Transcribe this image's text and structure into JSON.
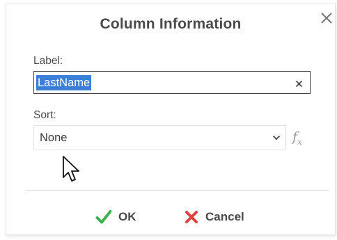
{
  "dialog": {
    "title": "Column Information"
  },
  "label_field": {
    "label": "Label:",
    "value": "LastName"
  },
  "sort_field": {
    "label": "Sort:",
    "value": "None"
  },
  "buttons": {
    "ok": "OK",
    "cancel": "Cancel"
  },
  "icons": {
    "close": "close-icon",
    "clear": "clear-icon",
    "dropdown": "chevron-down-icon",
    "formula": "fx-icon",
    "ok": "checkmark-icon",
    "cancel": "x-icon",
    "pointer": "mouse-cursor-icon"
  },
  "colors": {
    "selection": "#3d7ed6",
    "ok_green": "#3bb34a",
    "cancel_red": "#d9423a"
  }
}
